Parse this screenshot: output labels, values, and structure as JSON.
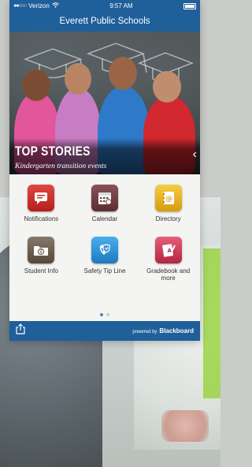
{
  "status": {
    "carrier": "Verizon",
    "time": "9:57 AM"
  },
  "app": {
    "title": "Everett Public Schools"
  },
  "hero": {
    "title": "TOP STORIES",
    "subtitle": "Kindergarten transition events"
  },
  "tiles": [
    {
      "label": "Notifications",
      "icon": "notifications-icon",
      "color": "#c7302b"
    },
    {
      "label": "Calendar",
      "icon": "calendar-icon",
      "color": "#6b3a3f"
    },
    {
      "label": "Directory",
      "icon": "directory-icon",
      "color": "#e6b21e"
    },
    {
      "label": "Student Info",
      "icon": "student-info-icon",
      "color": "#6b5d4a"
    },
    {
      "label": "Safety Tip Line",
      "icon": "safety-tip-line-icon",
      "color": "#2f8fd4"
    },
    {
      "label": "Gradebook and more",
      "icon": "gradebook-icon",
      "color": "#d03b5a"
    }
  ],
  "pager": {
    "pages": 2,
    "current": 1
  },
  "footer": {
    "powered_by": "powered by",
    "brand": "Blackboard",
    "share_icon": "share-icon"
  },
  "colors": {
    "brand_blue": "#1f5f9a"
  }
}
